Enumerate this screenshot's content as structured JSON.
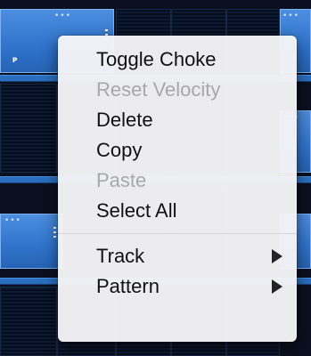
{
  "background": {
    "pad_color": "#3b7fd6",
    "track_bar_color": "#2a6fbf",
    "marker_glyph": "ᴘ",
    "pad_dots": "•••"
  },
  "context_menu": {
    "items": [
      {
        "label": "Toggle Choke",
        "enabled": true
      },
      {
        "label": "Reset Velocity",
        "enabled": false
      },
      {
        "label": "Delete",
        "enabled": true
      },
      {
        "label": "Copy",
        "enabled": true
      },
      {
        "label": "Paste",
        "enabled": false
      },
      {
        "label": "Select All",
        "enabled": true
      }
    ],
    "submenus": [
      {
        "label": "Track",
        "icon": "chevron-right-icon"
      },
      {
        "label": "Pattern",
        "icon": "chevron-right-icon"
      }
    ]
  }
}
